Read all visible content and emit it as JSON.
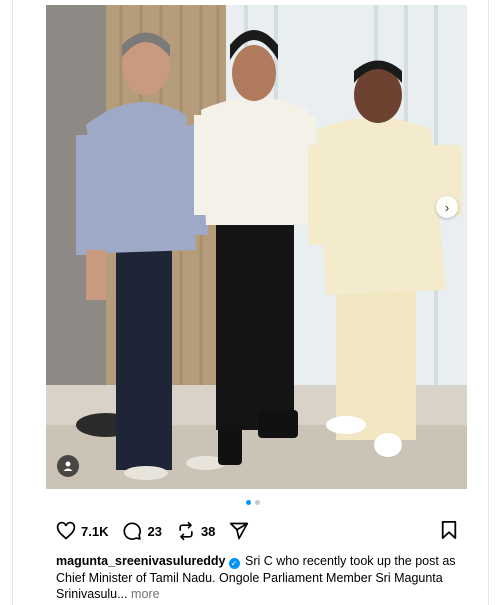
{
  "post": {
    "username": "magunta_sreenivasulureddy",
    "caption_line1": "Sri C who recently took up the post as",
    "caption_line2": "Chief Minister of Tamil Nadu. Ongole Parliament Member Sri Magunta",
    "caption_line3": "Srinivasulu...",
    "more_label": "more",
    "likes": "7.1K",
    "comments": "23",
    "reposts": "38",
    "carousel": {
      "count": 2,
      "current": 1
    },
    "icons": {
      "like": "heart-icon",
      "comment": "comment-icon",
      "repost": "repost-icon",
      "share": "send-icon",
      "save": "bookmark-icon",
      "next": "chevron-right-icon",
      "tags": "user-tag-icon",
      "verified": "verified-badge-icon"
    },
    "colors": {
      "accent": "#0095f6",
      "muted": "#737373"
    }
  }
}
